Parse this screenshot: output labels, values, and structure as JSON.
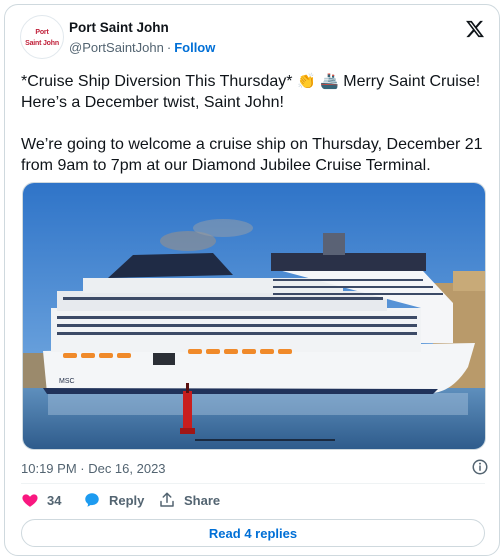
{
  "account": {
    "display_name": "Port Saint John",
    "handle": "@PortSaintJohn",
    "separator": "·",
    "follow_label": "Follow",
    "avatar_text_top": "Port",
    "avatar_text_bottom": "Saint John"
  },
  "tweet": {
    "line1_start": "*Cruise Ship Diversion This Thursday* ",
    "line1_end": " Merry Saint Cruise! Here’s a December twist, Saint John!",
    "paragraph2": "We’re going to welcome a cruise ship on Thursday, December 21 from 9am to 7pm at our Diamond Jubilee Cruise Terminal.",
    "emojis": [
      "clapping-hands",
      "cruise-ship"
    ],
    "photo_ship_text": "MSC",
    "timestamp": "10:19 PM · Dec 16, 2023"
  },
  "actions": {
    "like_count": "34",
    "reply_label": "Reply",
    "share_label": "Share",
    "read_replies_label": "Read 4 replies"
  },
  "colors": {
    "link": "#006fd6",
    "like": "#f91880",
    "reply_icon": "#1d9bf0",
    "muted": "#536471",
    "border": "#cfd9de"
  }
}
